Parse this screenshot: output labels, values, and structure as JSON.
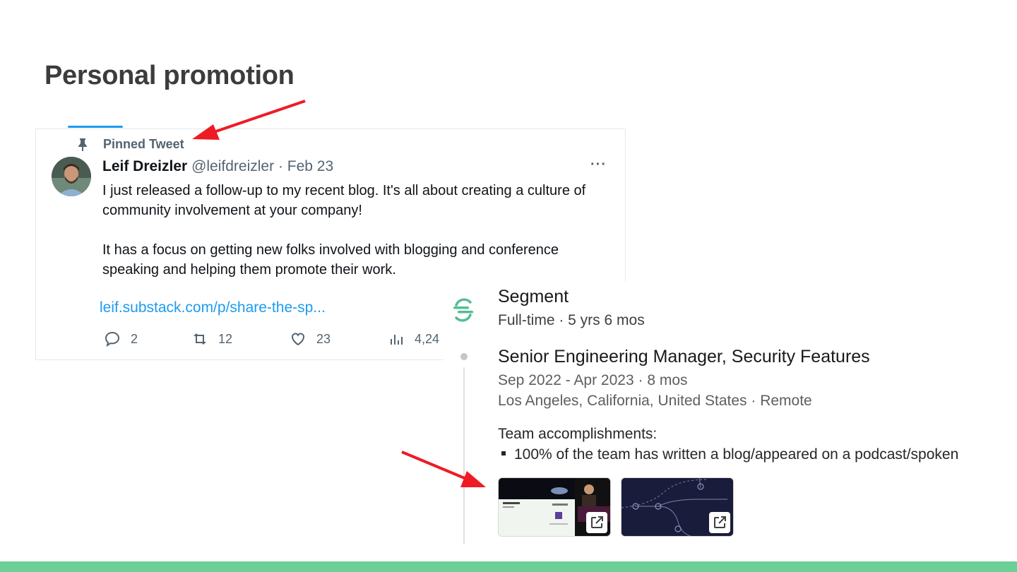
{
  "slide": {
    "title": "Personal promotion"
  },
  "tweet": {
    "pinned_label": "Pinned Tweet",
    "author_name": "Leif Dreizler",
    "author_handle": "@leifdreizler",
    "separator": "·",
    "date": "Feb 23",
    "more_label": "···",
    "paragraphs": [
      "I just released a follow-up to my recent blog. It's all about creating a culture of community involvement at your company!",
      "It has a focus on getting new folks involved with blogging and conference speaking and helping them promote their work."
    ],
    "link_text": "leif.substack.com/p/share-the-sp...",
    "actions": {
      "replies": "2",
      "retweets": "12",
      "likes": "23",
      "views": "4,24"
    }
  },
  "linkedin": {
    "company_name": "Segment",
    "company_meta": "Full-time · 5 yrs 6 mos",
    "role_title": "Senior Engineering Manager, Security Features",
    "role_dates": "Sep 2022 - Apr 2023 · 8 mos",
    "role_location": "Los Angeles, California, United States · Remote",
    "accomplishments_heading": "Team accomplishments:",
    "accomplishments": [
      "100% of the team has written a blog/appeared on a podcast/spoken"
    ]
  },
  "colors": {
    "link": "#1d9bf0",
    "annotation_arrow": "#ee1b24",
    "footer_bar": "#6ccf96",
    "segment_logo": "#52bd94"
  },
  "icons": {
    "pinned": "pin-icon",
    "reply": "speech-bubble-icon",
    "retweet": "retweet-icon",
    "like": "heart-icon",
    "views": "bar-chart-icon",
    "external": "external-link-icon"
  }
}
